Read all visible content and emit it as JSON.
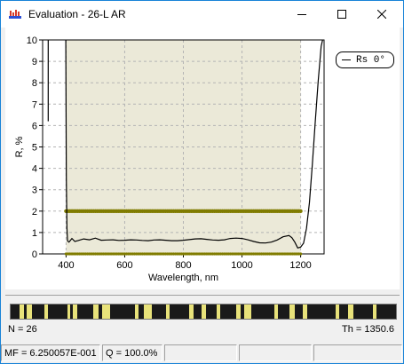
{
  "window": {
    "title": "Evaluation - 26-L AR",
    "minimize_icon": "minimize-icon",
    "maximize_icon": "maximize-icon",
    "close_icon": "close-icon"
  },
  "legend": {
    "label": "Rs 0°"
  },
  "design": {
    "layer_count": "N = 26",
    "thickness": "Th = 1350.6"
  },
  "status": {
    "merit_function": "MF = 6.250057E-001",
    "quality": "Q = 100.0%"
  },
  "colors": {
    "target_band": "#ebe9d8",
    "target_markers": "#807c00",
    "strip_high": "#e8e27a",
    "strip_low": "#1a1a1a"
  },
  "chart_data": {
    "type": "line",
    "title": "",
    "xlabel": "Wavelength, nm",
    "ylabel": "R, %",
    "xlim": [
      320,
      1280
    ],
    "ylim": [
      0,
      10
    ],
    "xticks": [
      400,
      600,
      800,
      1000,
      1200
    ],
    "yticks": [
      0,
      1,
      2,
      3,
      4,
      5,
      6,
      7,
      8,
      9,
      10
    ],
    "grid": true,
    "legend_position": "top-right",
    "target_band": {
      "x": [
        400,
        1200
      ],
      "y": [
        0,
        10
      ]
    },
    "target_lines": [
      {
        "y": 2,
        "x": [
          400,
          1200
        ]
      },
      {
        "y": 0,
        "x": [
          400,
          1200
        ]
      }
    ],
    "series": [
      {
        "name": "Rs 0°",
        "x": [
          330,
          334,
          338,
          341,
          343,
          345,
          346,
          350,
          360,
          380,
          392,
          396,
          399,
          401,
          403,
          405,
          410,
          420,
          430,
          440,
          460,
          480,
          500,
          520,
          540,
          560,
          580,
          600,
          620,
          640,
          660,
          680,
          700,
          720,
          740,
          760,
          780,
          800,
          820,
          840,
          860,
          880,
          900,
          920,
          940,
          960,
          980,
          1000,
          1020,
          1040,
          1060,
          1080,
          1100,
          1120,
          1140,
          1160,
          1170,
          1180,
          1190,
          1200,
          1210,
          1220,
          1230,
          1240,
          1250,
          1260,
          1270,
          1275
        ],
        "y": [
          null,
          null,
          null,
          null,
          null,
          null,
          null,
          null,
          null,
          null,
          null,
          null,
          10,
          3.5,
          1.2,
          0.6,
          0.55,
          0.72,
          0.58,
          0.62,
          0.7,
          0.66,
          0.74,
          0.64,
          0.65,
          0.66,
          0.63,
          0.64,
          0.66,
          0.65,
          0.63,
          0.62,
          0.65,
          0.66,
          0.64,
          0.62,
          0.62,
          0.64,
          0.67,
          0.7,
          0.71,
          0.68,
          0.65,
          0.64,
          0.66,
          0.72,
          0.74,
          0.72,
          0.66,
          0.58,
          0.52,
          0.51,
          0.55,
          0.65,
          0.8,
          0.86,
          0.76,
          0.55,
          0.28,
          0.32,
          0.5,
          1.2,
          2.4,
          4.2,
          6.2,
          8.1,
          9.7,
          10
        ]
      },
      {
        "name": "left-edge",
        "x": [
          339,
          339,
          339
        ],
        "y": [
          10,
          8,
          6.2
        ]
      }
    ],
    "x_tick_labels": [
      "400",
      "600",
      "800",
      "1000",
      "1200"
    ],
    "y_tick_labels": [
      "0",
      "1",
      "2",
      "3",
      "4",
      "5",
      "6",
      "7",
      "8",
      "9",
      "10"
    ]
  }
}
